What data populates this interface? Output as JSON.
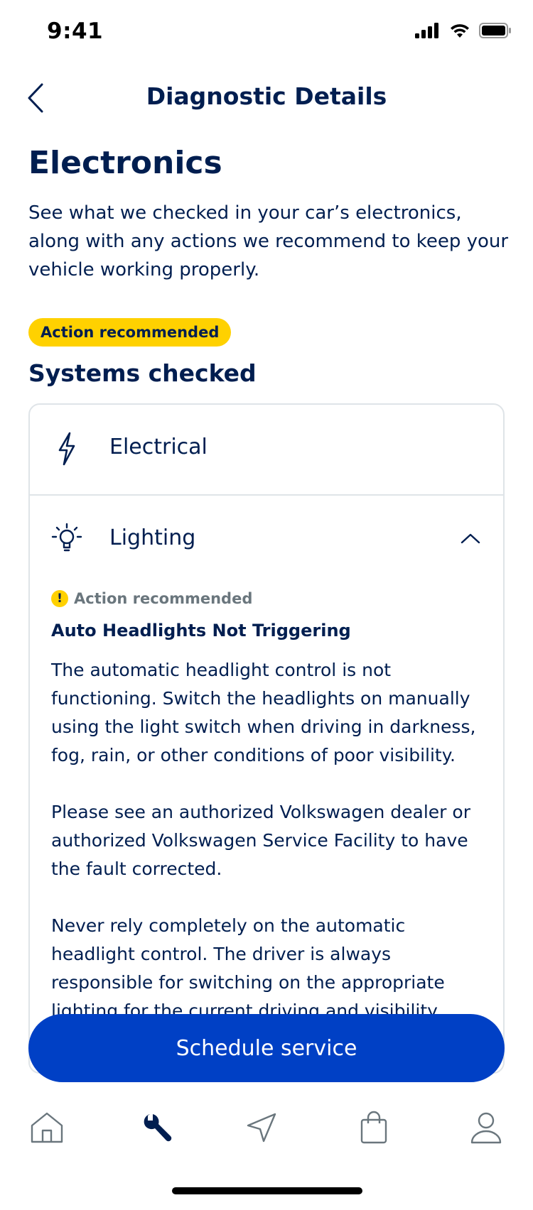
{
  "status_bar": {
    "time": "9:41"
  },
  "nav": {
    "title": "Diagnostic Details"
  },
  "page": {
    "title": "Electronics",
    "description": "See what we checked in your car’s electronics, along with any actions we recommend to keep your vehicle working properly.",
    "badge": "Action recommended"
  },
  "systems": {
    "section_title": "Systems checked",
    "items": [
      {
        "label": "Electrical",
        "icon": "lightning-icon"
      },
      {
        "label": "Lighting",
        "icon": "lightbulb-icon",
        "expanded": true
      }
    ],
    "detail": {
      "status": "Action recommended",
      "heading": "Auto Headlights Not Triggering",
      "paragraphs": [
        "The automatic headlight control is not functioning. Switch the headlights on manually using the light switch when driving in darkness, fog, rain, or other conditions of poor visibility.",
        "Please see an authorized Volkswagen dealer or authorized Volkswagen Service Facility to have the fault corrected.",
        "Never rely completely on the automatic headlight control. The driver is always responsible for switching on the appropriate lighting for the current driving and visibility"
      ]
    }
  },
  "cta": {
    "label": "Schedule service"
  },
  "tabbar": {
    "tabs": [
      {
        "icon": "home-icon",
        "active": false
      },
      {
        "icon": "wrench-icon",
        "active": true
      },
      {
        "icon": "navigation-icon",
        "active": false
      },
      {
        "icon": "shopping-bag-icon",
        "active": false
      },
      {
        "icon": "profile-icon",
        "active": false
      }
    ]
  },
  "colors": {
    "brand_dark": "#001e50",
    "primary": "#0040c5",
    "warning": "#ffd100",
    "border": "#dfe4e8",
    "muted": "#6a767d"
  }
}
